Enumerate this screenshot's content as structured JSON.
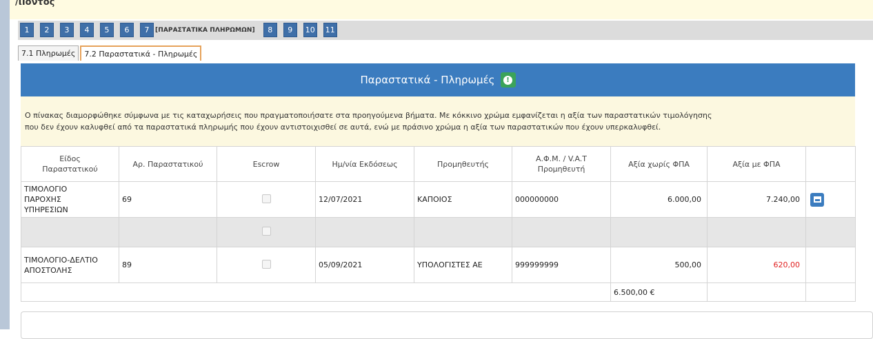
{
  "top": {
    "cut_label": "/ιΙοντος"
  },
  "steps": {
    "before": [
      "1",
      "2",
      "3",
      "4",
      "5",
      "6"
    ],
    "current": "7",
    "current_label": "[ΠΑΡΑΣΤΑΤΙΚΑ ΠΛΗΡΩΜΩΝ]",
    "after": [
      "8",
      "9",
      "10",
      "11"
    ]
  },
  "subtabs": {
    "tab1": "7.1 Πληρωμές",
    "tab2": "7.2 Παραστατικά - Πληρωμές"
  },
  "panel": {
    "title": "Παραστατικά - Πληρωμές",
    "info_icon": "info-icon",
    "notice_line1": "Ο πίνακας διαμορφώθηκε σύμφωνα με τις καταχωρήσεις που πραγματοποιήσατε στα προηγούμενα βήματα. Με κόκκινο χρώμα εμφανίζεται η αξία των παραστατικών τιμολόγησης",
    "notice_line2": "που δεν έχουν καλυφθεί από τα παραστατικά πληρωμής που έχουν αντιστοιχισθεί σε αυτά, ενώ με πράσινο χρώμα η αξία των παραστατικών που έχουν υπερκαλυφθεί."
  },
  "table": {
    "headers": {
      "type1": "Είδος",
      "type2": "Παραστατικού",
      "number": "Αρ. Παραστατικού",
      "escrow": "Escrow",
      "date": "Ημ/νία Εκδόσεως",
      "supplier": "Προμηθευτής",
      "afm1": "Α.Φ.Μ. / V.A.T",
      "afm2": "Προμηθευτή",
      "net": "Αξία χωρίς ΦΠΑ",
      "gross": "Αξία με ΦΠΑ"
    },
    "rows": [
      {
        "type1": "ΤΙΜΟΛΟΓΙΟ",
        "type2": "ΠΑΡΟΧΗΣ",
        "type3": "ΥΠΗΡΕΣΙΩΝ",
        "number": "69",
        "date": "12/07/2021",
        "supplier": "ΚΑΠΟΙΟΣ",
        "afm": "000000000",
        "net": "6.000,00",
        "gross": "7.240,00"
      },
      {
        "type1": "ΤΙΜΟΛΟΓΙΟ-ΔΕΛΤΙΟ",
        "type2": "ΑΠΟΣΤΟΛΗΣ",
        "number": "89",
        "date": "05/09/2021",
        "supplier": "ΥΠΟΛΟΓΙΣΤΕΣ ΑΕ",
        "afm": "999999999",
        "net": "500,00",
        "gross": "620,00"
      }
    ],
    "total_net": "6.500,00 €"
  },
  "colors": {
    "header_blue": "#3b7cbf",
    "step_blue": "#3f6fa8",
    "notice_bg": "#fcf8e0",
    "uncovered_red": "#e02020",
    "info_green": "#3ba35a"
  }
}
